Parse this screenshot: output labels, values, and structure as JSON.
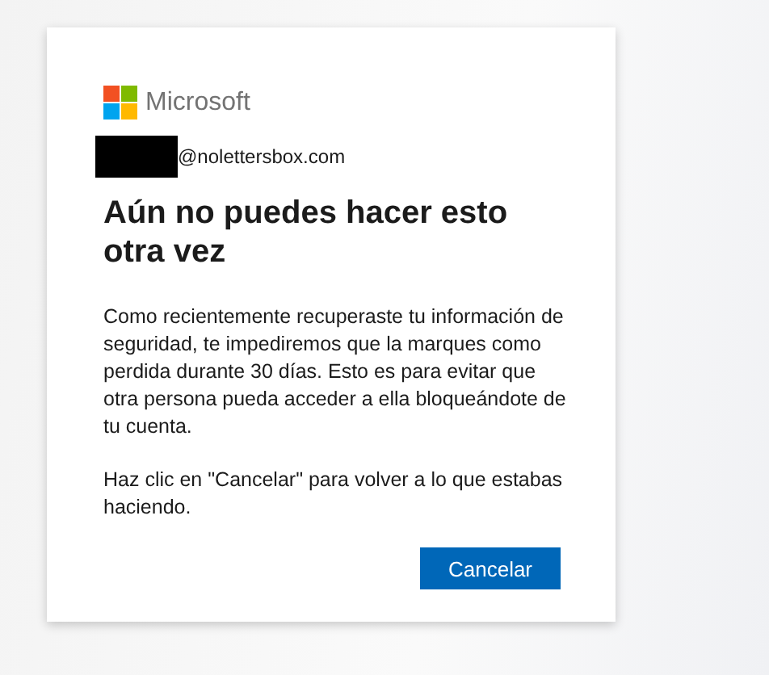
{
  "brand": {
    "name": "Microsoft"
  },
  "account": {
    "email": "@nolettersbox.com"
  },
  "title": "Aún no puedes hacer esto otra vez",
  "paragraphs": [
    "Como recientemente recuperaste tu información de seguridad, te impediremos que la marques como perdida durante 30 días. Esto es para evitar que otra persona pueda acceder a ella bloqueándote de tu cuenta.",
    "Haz clic en \"Cancelar\" para volver a lo que estabas haciendo."
  ],
  "buttons": [
    "Cancelar"
  ]
}
